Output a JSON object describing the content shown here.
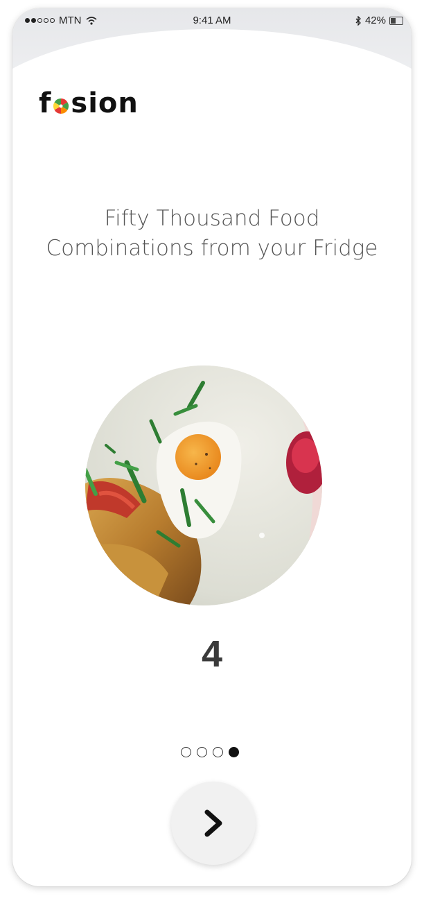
{
  "status_bar": {
    "carrier": "MTN",
    "time": "9:41 AM",
    "battery": "42%",
    "battery_level": 0.42,
    "signal_bars_filled": 2,
    "signal_bars_total": 5
  },
  "logo": {
    "prefix": "f",
    "suffix": "sion",
    "mark_icon": "citrus-slice-icon"
  },
  "headline": {
    "line1": "Fifty Thousand Food",
    "line2": "Combinations from your Fridge"
  },
  "hero_image": {
    "icon": "food-photo"
  },
  "page_number": "4",
  "pager": {
    "total": 4,
    "active_index": 3
  },
  "next_button": {
    "icon": "chevron-right-icon"
  },
  "colors": {
    "background": "#ffffff",
    "top_band": "#e6e7ea",
    "text_dark": "#111111",
    "headline_text": "#555555",
    "next_button_bg": "#f1f1f1"
  }
}
